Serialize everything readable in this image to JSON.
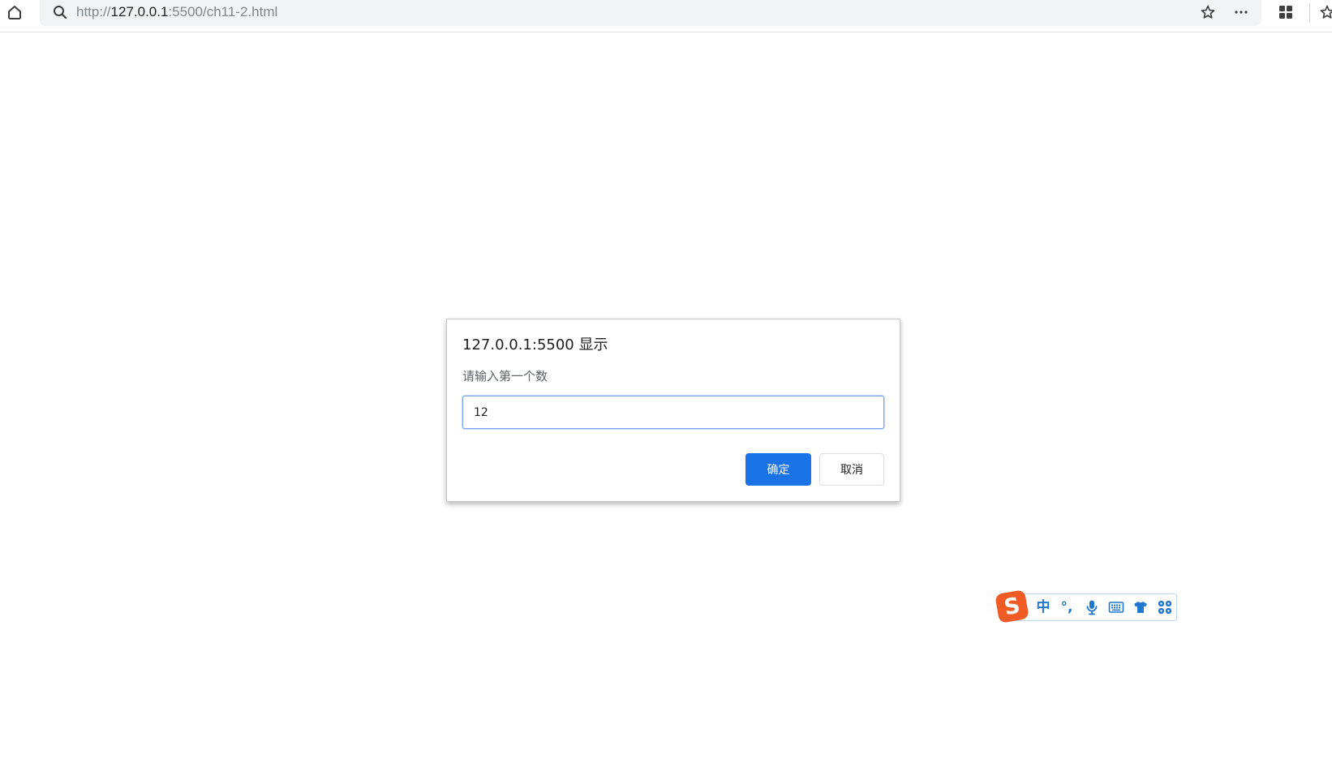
{
  "browser": {
    "address": {
      "scheme": "http://",
      "host": "127.0.0.1",
      "path": ":5500/ch11-2.html"
    },
    "icons": {
      "home": "home-icon",
      "search": "search-icon",
      "favorite": "star-outline-icon",
      "more": "more-horizontal-icon",
      "apps": "apps-grid-icon",
      "favorites": "favorites-star-icon"
    }
  },
  "dialog": {
    "title": "127.0.0.1:5500 显示",
    "message": "请输入第一个数",
    "input": {
      "value": "12"
    },
    "ok_button": "确定",
    "cancel_button": "取消"
  },
  "ime_toolbar": {
    "logo_letter": "S",
    "mode": "中",
    "punctuation": "°,",
    "icons": [
      "voice-input-icon",
      "soft-keyboard-icon",
      "skin-shirt-icon",
      "toolbox-icon"
    ]
  },
  "colors": {
    "primary_button": "#1a73e8",
    "input_focus_border": "#7aa7f0",
    "address_bar_bg": "#f1f3f4",
    "ime_icon": "#1f77d0",
    "ime_logo": "#f05a24"
  }
}
